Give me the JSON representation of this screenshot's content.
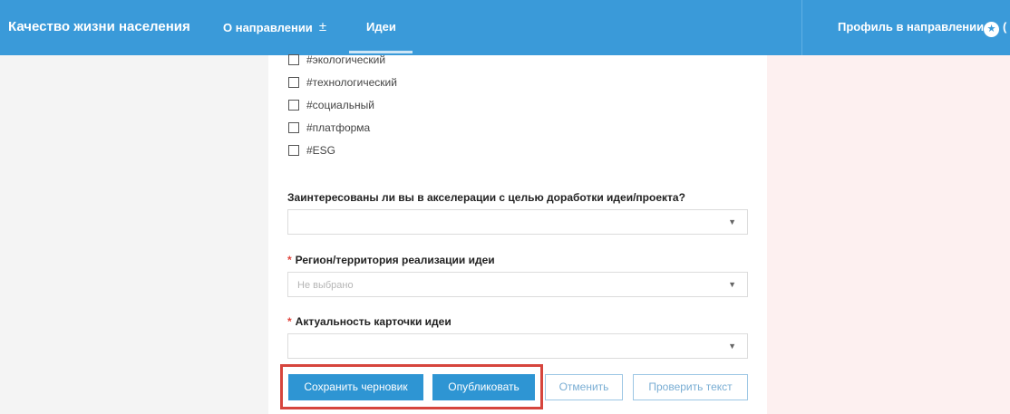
{
  "header": {
    "brand": "Качество жизни населения",
    "nav": {
      "about": "О направлении",
      "ideas": "Идеи",
      "profile": "Профиль в направлении"
    },
    "icons": [
      "plus-minus-icon",
      "star-icon"
    ],
    "background_color": "#3a9ad9"
  },
  "form": {
    "tags": [
      "#экологический",
      "#технологический",
      "#социальный",
      "#платформа",
      "#ESG"
    ],
    "acceleration": {
      "label": "Заинтересованы ли вы в акселерации с целью доработки идеи/проекта?",
      "value": ""
    },
    "region": {
      "required_mark": "*",
      "label": "Регион/территория реализации идеи",
      "placeholder": "Не выбрано"
    },
    "relevance": {
      "required_mark": "*",
      "label": "Актуальность карточки идеи",
      "value": ""
    },
    "buttons": {
      "save_draft": "Сохранить черновик",
      "publish": "Опубликовать",
      "cancel": "Отменить",
      "check_text": "Проверить текст"
    },
    "highlight_color": "#d6453d"
  }
}
